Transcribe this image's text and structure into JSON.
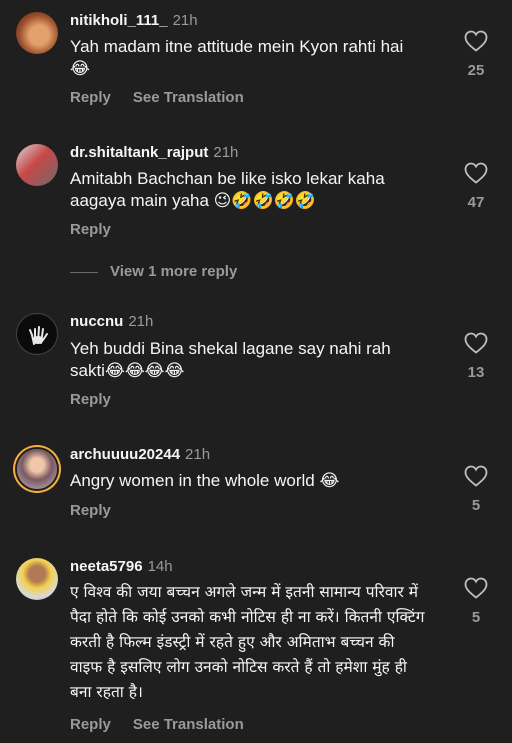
{
  "comments": [
    {
      "username": "nitikholi_111_",
      "time": "21h",
      "text": "Yah madam itne attitude mein Kyon rahti hai😂",
      "likes": "25",
      "reply_label": "Reply",
      "translate_label": "See Translation"
    },
    {
      "username": "dr.shitaltank_rajput",
      "time": "21h",
      "text": "Amitabh Bachchan be like isko lekar kaha aagaya main yaha 😉🤣🤣🤣🤣",
      "likes": "47",
      "reply_label": "Reply",
      "more_replies": "View 1 more reply"
    },
    {
      "username": "nuccnu",
      "time": "21h",
      "text": "Yeh buddi Bina shekal lagane say nahi rah sakti😂😂😂😂",
      "likes": "13",
      "reply_label": "Reply"
    },
    {
      "username": "archuuuu20244",
      "time": "21h",
      "text": "Angry women in the whole world 😂",
      "likes": "5",
      "reply_label": "Reply"
    },
    {
      "username": "neeta5796",
      "time": "14h",
      "text": "ए विश्व की जया बच्चन अगले जन्म में इतनी सामान्य परिवार में पैदा होते कि  कोई उनको कभी नोटिस ही ना करें। कितनी एक्टिंग करती है फिल्म इंडस्ट्री में रहते हुए और अमिताभ बच्चन की वाइफ है इसलिए लोग उनको नोटिस करते हैं तो हमेशा मुंह ही बना रहता है।",
      "likes": "5",
      "reply_label": "Reply",
      "translate_label": "See Translation"
    }
  ],
  "icons": {
    "like": "heart-outline-icon"
  },
  "colors": {
    "background": "#1f1f1f",
    "primary_text": "#f5f5f5",
    "secondary_text": "#9a9a9a",
    "story_ring": "#f3b23a"
  }
}
